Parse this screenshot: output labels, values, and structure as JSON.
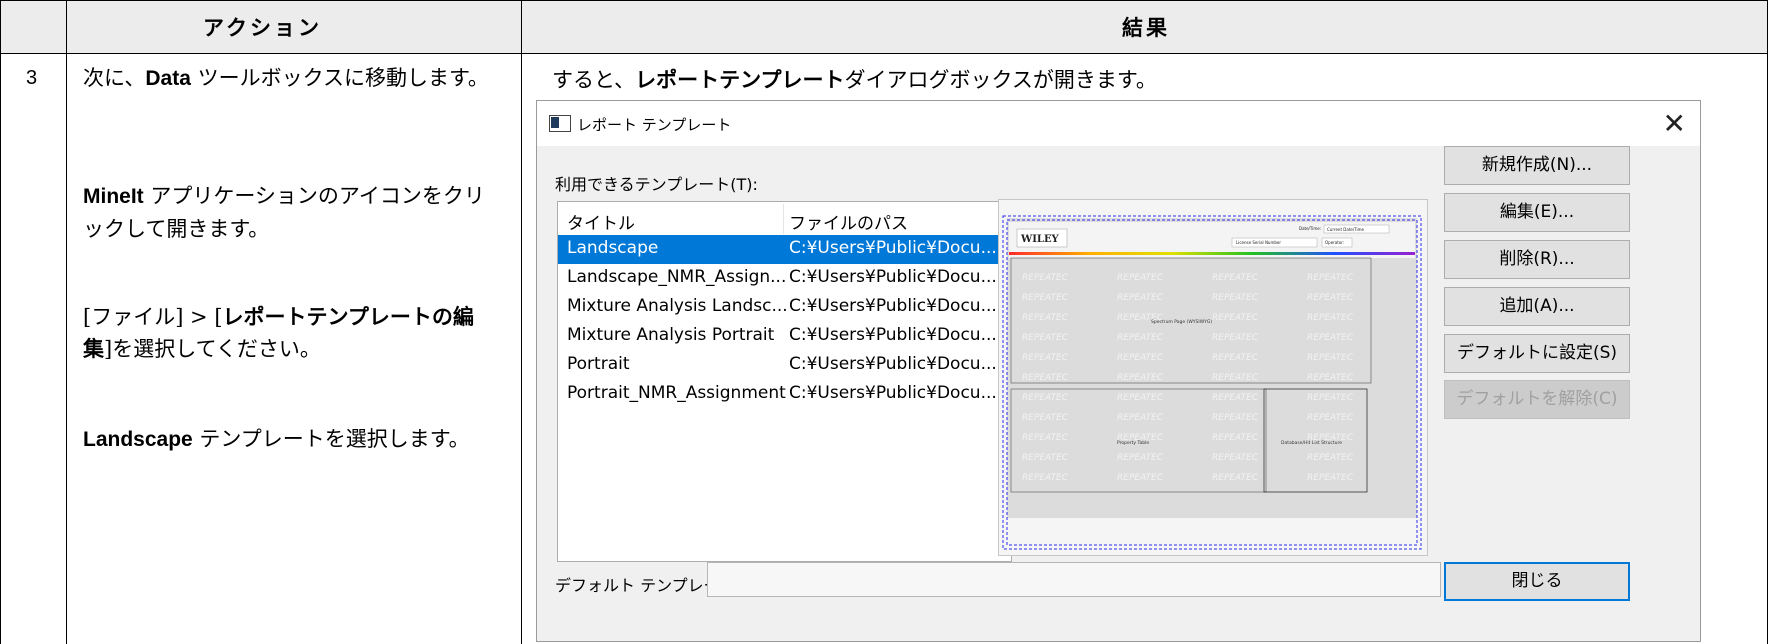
{
  "table": {
    "header": {
      "action": "アクション",
      "result": "結果"
    },
    "step_number": "3",
    "action_parts": [
      {
        "pre": "次に、",
        "bold": "Data",
        "post": " ツールボックスに移動します。"
      },
      {
        "pre": "",
        "bold": "MineIt",
        "post": " アプリケーションのアイコンをクリックして開きます。"
      },
      {
        "pre": "[ファイル] > [",
        "bold": "レポートテンプレートの編集",
        "post": "]を選択してください。"
      },
      {
        "pre": "",
        "bold": "Landscape",
        "post": " テンプレートを選択します。"
      }
    ],
    "result_intro": {
      "pre": "すると、",
      "bold": "レポートテンプレート",
      "post": "ダイアログボックスが開きます。"
    }
  },
  "dialog": {
    "title": "レポート テンプレート",
    "close_icon": "close-icon",
    "available_label": "利用できるテンプレート(T):",
    "columns": [
      "タイトル",
      "ファイルのパス"
    ],
    "rows": [
      {
        "title": "Landscape",
        "path": "C:¥Users¥Public¥Docu...",
        "selected": true
      },
      {
        "title": "Landscape_NMR_Assign...",
        "path": "C:¥Users¥Public¥Docu...",
        "selected": false
      },
      {
        "title": "Mixture Analysis Landsc...",
        "path": "C:¥Users¥Public¥Docu...",
        "selected": false
      },
      {
        "title": "Mixture Analysis Portrait",
        "path": "C:¥Users¥Public¥Docu...",
        "selected": false
      },
      {
        "title": "Portrait",
        "path": "C:¥Users¥Public¥Docu...",
        "selected": false
      },
      {
        "title": "Portrait_NMR_Assignment",
        "path": "C:¥Users¥Public¥Docu...",
        "selected": false
      }
    ],
    "preview": {
      "logo": "WILEY",
      "datetime_label": "Date/Time:",
      "datetime_value": "Current Date/Time",
      "license_label": "License Serial Number",
      "operator_label": "Operator:",
      "watermark": "REPEATEC",
      "spectrum_label": "Spectrum Page (WYSIWYG)",
      "property_label": "Property Table",
      "database_label": "Database/Hit List Structure"
    },
    "buttons": [
      "新規作成(N)...",
      "編集(E)...",
      "削除(R)...",
      "追加(A)...",
      "デフォルトに設定(S)",
      "デフォルトを解除(C)"
    ],
    "default_label": "デフォルト テンプレート:",
    "default_value": "",
    "close_button": "閉じる",
    "selection_color": "#0078d7",
    "accent_color": "#0078d7"
  }
}
